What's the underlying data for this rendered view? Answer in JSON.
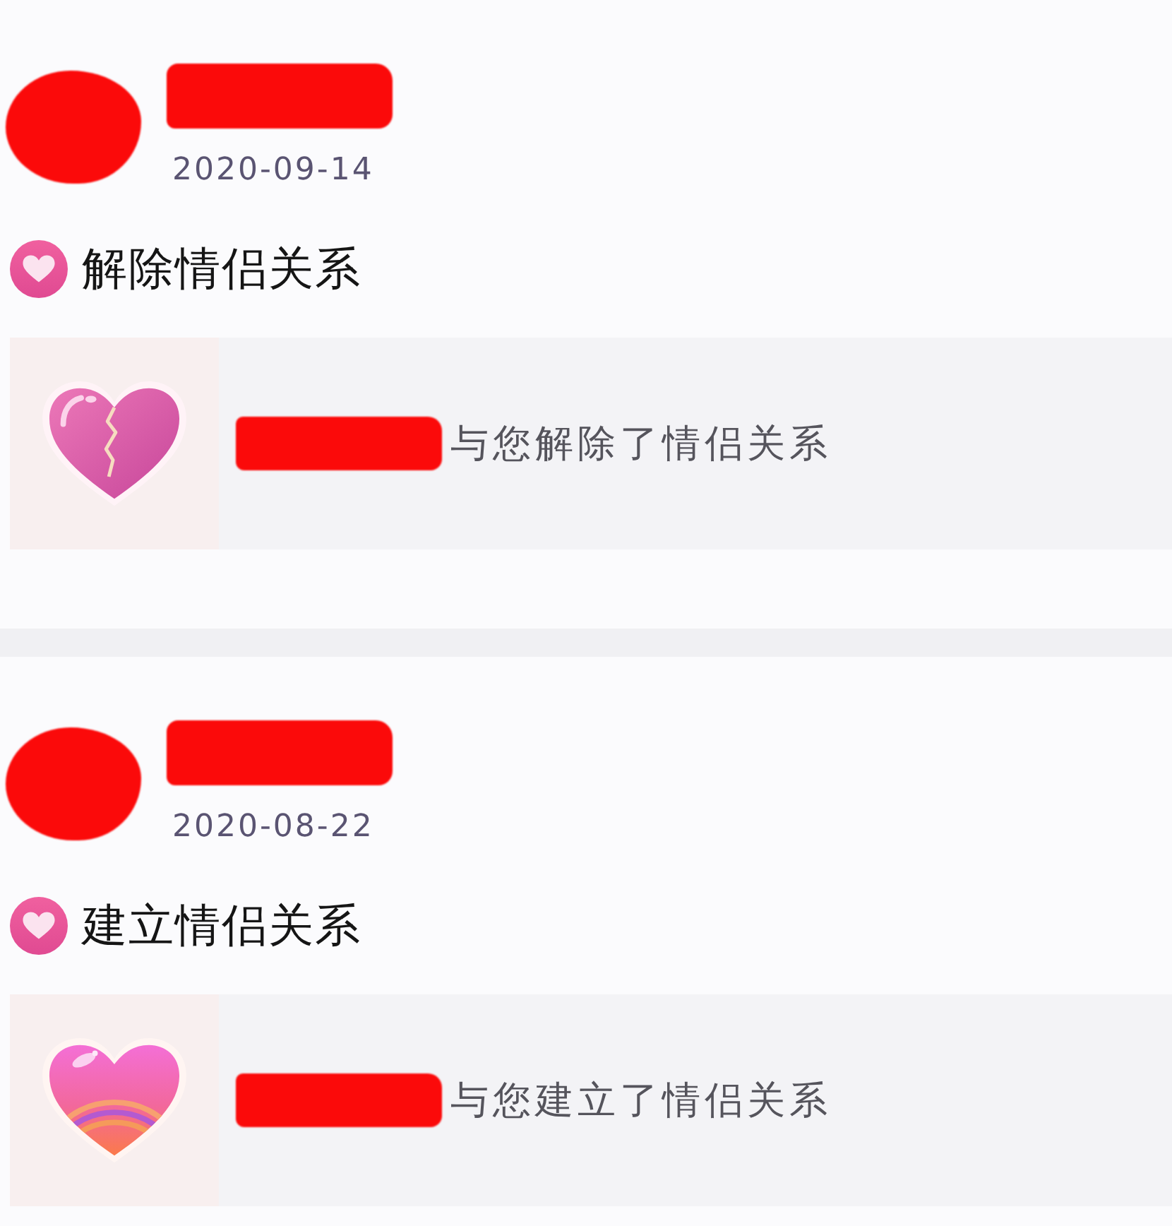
{
  "records": [
    {
      "kind": "breakup",
      "avatar_redacted": true,
      "name_redacted": true,
      "date": "2020-09-14",
      "title": "解除情侣关系",
      "notice": {
        "name_redacted": true,
        "text": "与您解除了情侣关系"
      }
    },
    {
      "kind": "couple",
      "avatar_redacted": true,
      "name_redacted": true,
      "date": "2020-08-22",
      "title": "建立情侣关系",
      "notice": {
        "name_redacted": true,
        "text": "与您建立了情侣关系"
      }
    }
  ]
}
